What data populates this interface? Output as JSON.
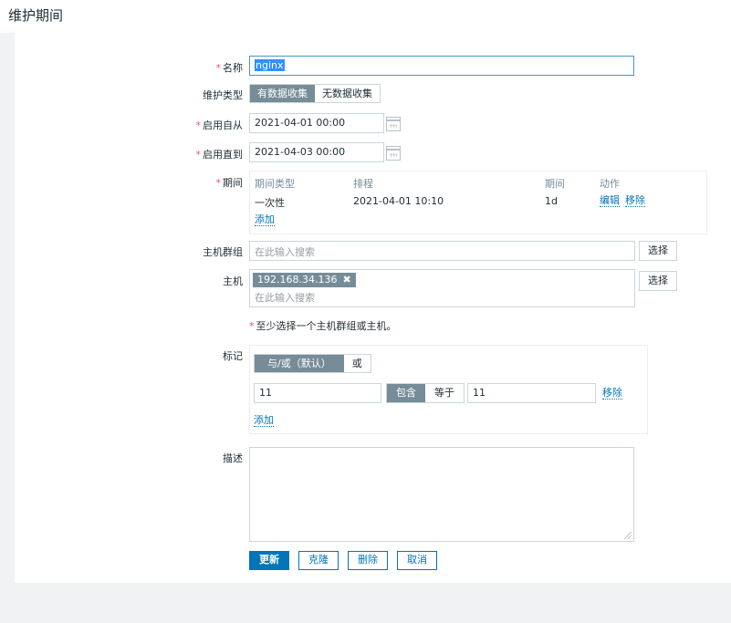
{
  "page": {
    "title": "维护期间"
  },
  "form": {
    "name": {
      "label": "名称",
      "value": "nginx"
    },
    "maintenance_type": {
      "label": "维护类型",
      "options": [
        "有数据收集",
        "无数据收集"
      ],
      "selected": "有数据收集"
    },
    "active_since": {
      "label": "启用自从",
      "value": "2021-04-01 00:00"
    },
    "active_till": {
      "label": "启用直到",
      "value": "2021-04-03 00:00"
    },
    "periods": {
      "label": "期间",
      "headers": [
        "期间类型",
        "排程",
        "期间",
        "动作"
      ],
      "rows": [
        {
          "type": "一次性",
          "schedule": "2021-04-01 10:10",
          "period": "1d",
          "edit": "编辑",
          "remove": "移除"
        }
      ],
      "add_label": "添加"
    },
    "host_groups": {
      "label": "主机群组",
      "placeholder": "在此输入搜索",
      "select_label": "选择"
    },
    "hosts": {
      "label": "主机",
      "chips": [
        "192.168.34.136"
      ],
      "placeholder": "在此输入搜索",
      "select_label": "选择"
    },
    "hint": "至少选择一个主机群组或主机。",
    "tags": {
      "label": "标记",
      "eval_options": [
        "与/或（默认）",
        "或"
      ],
      "eval_selected": "与/或（默认）",
      "rows": [
        {
          "tag": "11",
          "operators": [
            "包含",
            "等于"
          ],
          "operator": "包含",
          "value": "11",
          "remove": "移除"
        }
      ],
      "add_label": "添加"
    },
    "description": {
      "label": "描述",
      "value": ""
    }
  },
  "buttons": {
    "update": "更新",
    "clone": "克隆",
    "delete": "删除",
    "cancel": "取消"
  },
  "colors": {
    "primary": "#0275b8",
    "toggle_on": "#768d99",
    "required": "#e45959",
    "link": "#0275b8"
  }
}
